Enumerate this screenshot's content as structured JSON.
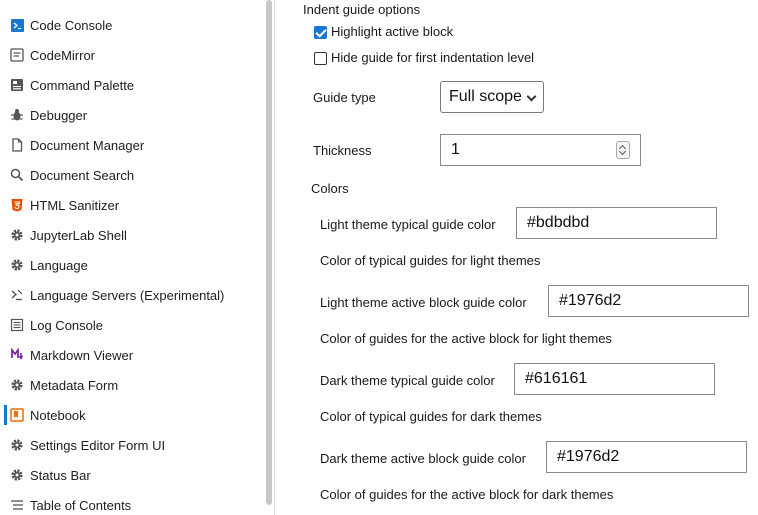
{
  "sidebar": {
    "items": [
      {
        "label": "Code Console",
        "icon": "terminal-icon"
      },
      {
        "label": "CodeMirror",
        "icon": "editor-icon"
      },
      {
        "label": "Command Palette",
        "icon": "palette-icon"
      },
      {
        "label": "Debugger",
        "icon": "bug-icon"
      },
      {
        "label": "Document Manager",
        "icon": "document-icon"
      },
      {
        "label": "Document Search",
        "icon": "search-icon"
      },
      {
        "label": "HTML Sanitizer",
        "icon": "html5-icon"
      },
      {
        "label": "JupyterLab Shell",
        "icon": "gear-icon"
      },
      {
        "label": "Language",
        "icon": "gear-icon"
      },
      {
        "label": "Language Servers (Experimental)",
        "icon": "language-server-icon"
      },
      {
        "label": "Log Console",
        "icon": "list-icon"
      },
      {
        "label": "Markdown Viewer",
        "icon": "markdown-icon"
      },
      {
        "label": "Metadata Form",
        "icon": "gear-icon"
      },
      {
        "label": "Notebook",
        "icon": "notebook-icon",
        "active": true
      },
      {
        "label": "Settings Editor Form UI",
        "icon": "gear-icon"
      },
      {
        "label": "Status Bar",
        "icon": "gear-icon"
      },
      {
        "label": "Table of Contents",
        "icon": "toc-icon"
      }
    ]
  },
  "main": {
    "section_title": "Indent guide options",
    "highlight_active_block": {
      "label": "Highlight active block",
      "checked": true
    },
    "hide_first_level": {
      "label": "Hide guide for first indentation level",
      "checked": false
    },
    "guide_type": {
      "label": "Guide type",
      "value": "Full scope"
    },
    "thickness": {
      "label": "Thickness",
      "value": "1"
    },
    "colors_title": "Colors",
    "light_typical": {
      "label": "Light theme typical guide color",
      "value": "#bdbdbd",
      "description": "Color of typical guides for light themes"
    },
    "light_active": {
      "label": "Light theme active block guide color",
      "value": "#1976d2",
      "description": "Color of guides for the active block for light themes"
    },
    "dark_typical": {
      "label": "Dark theme typical guide color",
      "value": "#616161",
      "description": "Color of typical guides for dark themes"
    },
    "dark_active": {
      "label": "Dark theme active block guide color",
      "value": "#1976d2",
      "description": "Color of guides for the active block for dark themes"
    }
  },
  "colors": {
    "accent": "#1976d2",
    "html5": "#e65100",
    "markdown": "#7b1fa2",
    "notebook": "#ef6c00"
  }
}
